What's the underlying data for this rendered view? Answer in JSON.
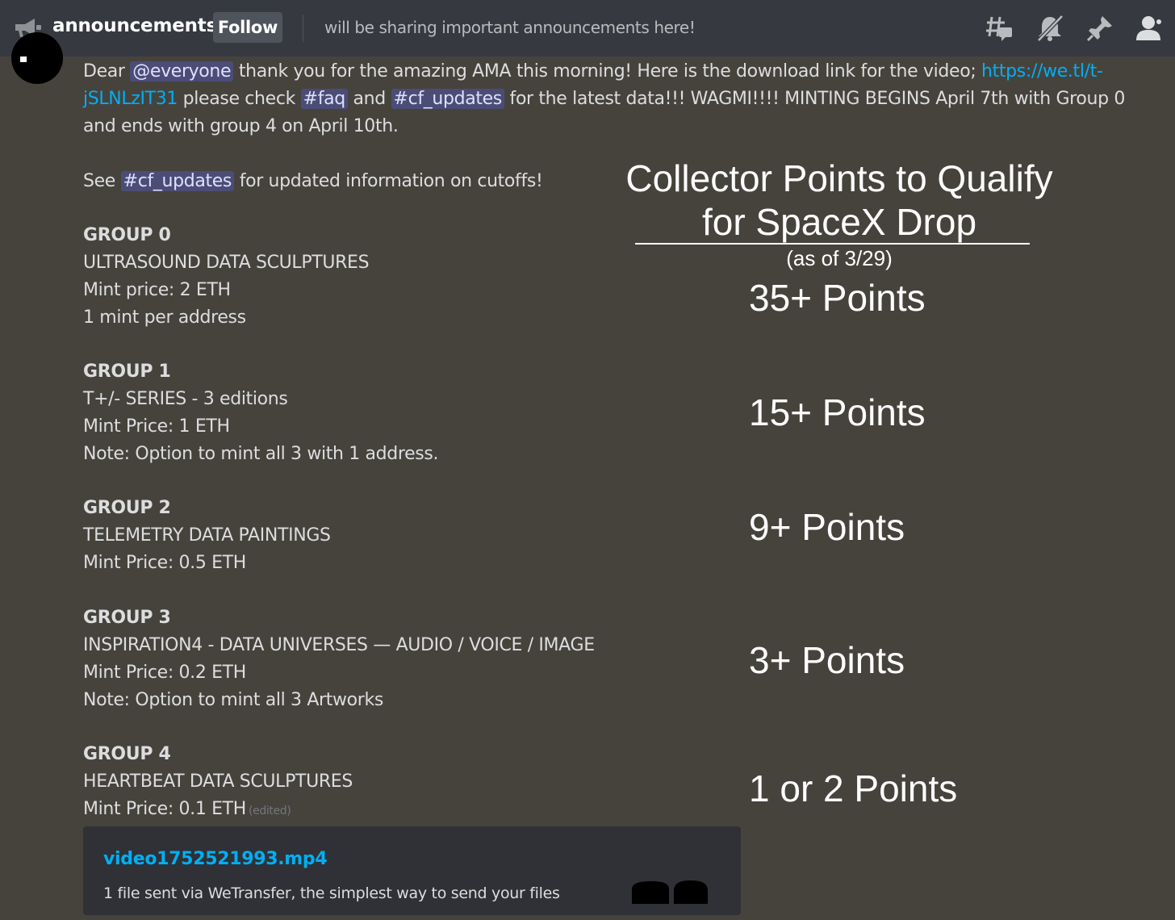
{
  "header": {
    "channel_name": "announcements",
    "follow_label": "Follow",
    "topic": "will be sharing important announcements here!",
    "icons": [
      "threads-icon",
      "notifications-muted-icon",
      "pin-icon",
      "members-icon"
    ]
  },
  "message": {
    "line1_prefix": "Dear ",
    "mention_everyone": "@everyone",
    "line1_text": " thank you for the amazing AMA this morning! Here is the download link for the video; ",
    "video_link": "https://we.tl/t-jSLNLzIT31",
    "please_check": " please check ",
    "faq_channel": "#faq",
    "and": " and ",
    "cf_channel": "#cf_updates",
    "line_rest": " for the latest data!!! WAGMI!!!! MINTING BEGINS April 7th with Group 0 and ends with group 4 on April 10th.",
    "see_prefix": "See ",
    "see_channel": "#cf_updates",
    "see_suffix": " for updated information on cutoffs!",
    "edited_label": "(edited)"
  },
  "groups": [
    {
      "title": "GROUP 0",
      "lines": [
        "ULTRASOUND DATA SCULPTURES",
        "Mint price: 2 ETH",
        "1 mint per address"
      ]
    },
    {
      "title": "GROUP 1",
      "lines": [
        "T+/- SERIES - 3 editions",
        "Mint Price: 1 ETH",
        "Note: Option to mint all 3 with 1 address."
      ]
    },
    {
      "title": "GROUP 2",
      "lines": [
        "TELEMETRY DATA PAINTINGS",
        "Mint Price: 0.5 ETH"
      ]
    },
    {
      "title": "GROUP 3",
      "lines": [
        "INSPIRATION4 - DATA UNIVERSES — AUDIO / VOICE / IMAGE",
        "Mint Price: 0.2 ETH",
        "Note: Option to mint all 3 Artworks"
      ]
    },
    {
      "title": "GROUP 4",
      "lines": [
        "HEARTBEAT DATA SCULPTURES",
        "Mint Price: 0.1 ETH"
      ]
    }
  ],
  "overlay": {
    "title_line1": "Collector Points to Qualify",
    "title_line2": "for SpaceX Drop",
    "subtitle": "(as of 3/29)",
    "points": [
      "35+ Points",
      "15+ Points",
      "9+ Points",
      "3+ Points",
      "1 or 2 Points"
    ]
  },
  "embed": {
    "title": "video1752521993.mp4",
    "description": "1 file sent via WeTransfer, the simplest way to send your files"
  },
  "colors": {
    "background": "#46433d",
    "header": "#36393f",
    "link": "#00aff4",
    "mention_bg": "#4a4f86"
  }
}
